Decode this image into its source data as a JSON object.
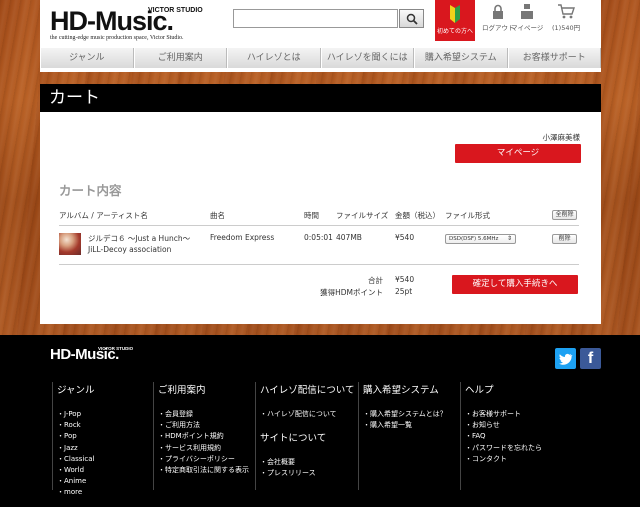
{
  "header": {
    "logo_text": "HD-Music.",
    "logo_studio": "VICTOR STUDIO",
    "tagline": "the cutting-edge music production space, Victor Studio.",
    "search_placeholder": "",
    "beginner_label": "初めての方へ",
    "logout_label": "ログアウト",
    "mypage_label": "マイページ",
    "cart_label": "(1)540円"
  },
  "nav": [
    "ジャンル",
    "ご利用案内",
    "ハイレゾとは",
    "ハイレゾを聞くには",
    "購入希望システム",
    "お客様サポート"
  ],
  "page_title": "カート",
  "cart": {
    "user_name": "小澤麻美様",
    "mypage_button": "マイページ",
    "section_title": "カート内容",
    "columns": {
      "album_artist": "アルバム / アーティスト名",
      "track": "曲名",
      "time": "時間",
      "filesize": "ファイルサイズ",
      "price": "金額（税込）",
      "format": "ファイル形式"
    },
    "delete_all_label": "全削除",
    "items": [
      {
        "album": "ジルデコ６ 〜Just a Hunch〜",
        "artist": "JiLL-Decoy association",
        "track": "Freedom Express",
        "time": "0:05:01",
        "filesize": "407MB",
        "price": "¥540",
        "format": "DSD(DSF) 5.6MHz",
        "delete_label": "削除"
      }
    ],
    "total_label": "合計",
    "total_value": "¥540",
    "points_label": "獲得HDMポイント",
    "points_value": "25pt",
    "checkout_button": "確定して購入手続きへ"
  },
  "footer": {
    "logo_text": "HD-Music.",
    "logo_studio": "VICTOR STUDIO",
    "twitter_icon": "twitter-icon",
    "facebook_icon": "facebook-icon",
    "columns": [
      {
        "heading": "ジャンル",
        "links": [
          "・J-Pop",
          "・Rock",
          "・Pop",
          "・Jazz",
          "・Classical",
          "・World",
          "・Anime",
          "・more"
        ]
      },
      {
        "heading": "ご利用案内",
        "links": [
          "・会員登録",
          "・ご利用方法",
          "・HDMポイント規約",
          "・サービス利用規約",
          "・プライバシーポリシー",
          "・特定商取引法に関する表示"
        ]
      },
      {
        "heading": "ハイレゾ配信について",
        "links": [
          "・ハイレゾ配信について"
        ],
        "heading2": "サイトについて",
        "links2": [
          "・会社概要",
          "・プレスリリース"
        ]
      },
      {
        "heading": "購入希望システム",
        "links": [
          "・購入希望システムとは？",
          "・購入希望一覧"
        ]
      },
      {
        "heading": "ヘルプ",
        "links": [
          "・お客様サポート",
          "・お知らせ",
          "・FAQ",
          "・パスワードを忘れたら",
          "・コンタクト"
        ]
      }
    ]
  },
  "colors": {
    "accent_red": "#d9171e",
    "wood": "#a8501c",
    "twitter": "#1da1f2",
    "facebook": "#3b5998"
  }
}
